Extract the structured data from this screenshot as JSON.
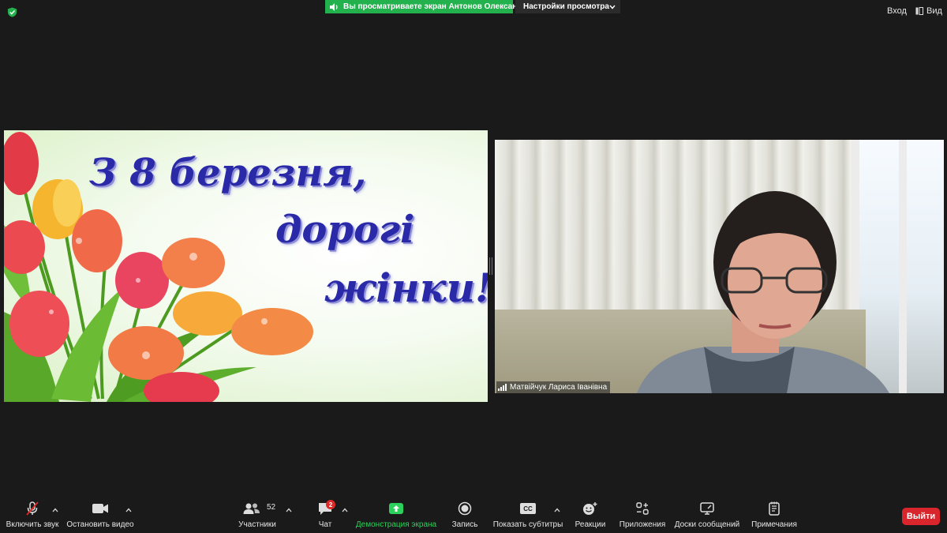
{
  "top": {
    "share_banner": "Вы просматриваете экран Антонов Олександр",
    "view_options": "Настройки просмотра",
    "sign_in": "Вход",
    "view": "Вид"
  },
  "slide": {
    "line1": "З 8 березня,",
    "line2": "дорогі",
    "line3": "жінки!"
  },
  "participant": {
    "name": "Матвійчук Лариса Іванівна"
  },
  "toolbar": {
    "unmute": "Включить звук",
    "stop_video": "Остановить видео",
    "participants": "Участники",
    "participants_count": "52",
    "chat": "Чат",
    "chat_badge": "2",
    "share_screen": "Демонстрация экрана",
    "record": "Запись",
    "captions": "Показать субтитры",
    "captions_icon_text": "CC",
    "reactions": "Реакции",
    "apps": "Приложения",
    "whiteboards": "Доски сообщений",
    "notes": "Примечания",
    "leave": "Выйти"
  },
  "colors": {
    "share_green": "#23b14d",
    "leave_red": "#d9262c",
    "greeting_blue": "#2a2aa8"
  }
}
